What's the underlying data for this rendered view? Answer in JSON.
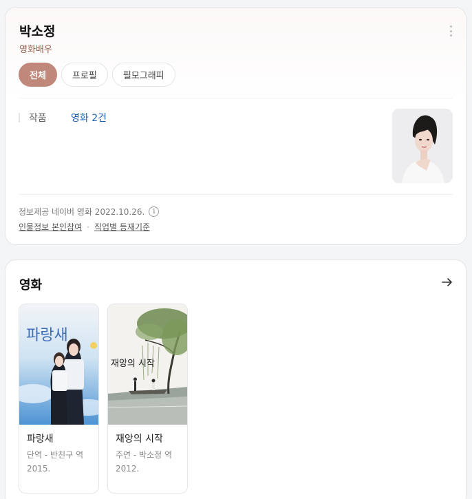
{
  "profile": {
    "name": "박소정",
    "occupation": "영화배우",
    "tabs": [
      {
        "label": "전체",
        "active": true
      },
      {
        "label": "프로필",
        "active": false
      },
      {
        "label": "필모그래피",
        "active": false
      }
    ],
    "works_label": "작품",
    "works_value": "영화 2건",
    "source_text": "정보제공 네이버 영화 2022.10.26.",
    "info_icon": "i",
    "link_self_edit": "인물정보 본인참여",
    "link_separator": "·",
    "link_criteria": "직업별 등재기준"
  },
  "movies": {
    "section_title": "영화",
    "items": [
      {
        "title": "파랑새",
        "role": "단역 - 반친구 역",
        "year": "2015.",
        "poster_text": "파랑새"
      },
      {
        "title": "재앙의 시작",
        "role": "주연 - 박소정 역",
        "year": "2012.",
        "poster_text": "재앙의 시작"
      }
    ]
  },
  "colors": {
    "accent": "#c0887a",
    "occupation": "#9a5d4c",
    "link": "#1a5fb4"
  },
  "icons": {
    "more": "more-vertical-icon",
    "info": "info-icon",
    "arrow": "arrow-right-icon"
  }
}
